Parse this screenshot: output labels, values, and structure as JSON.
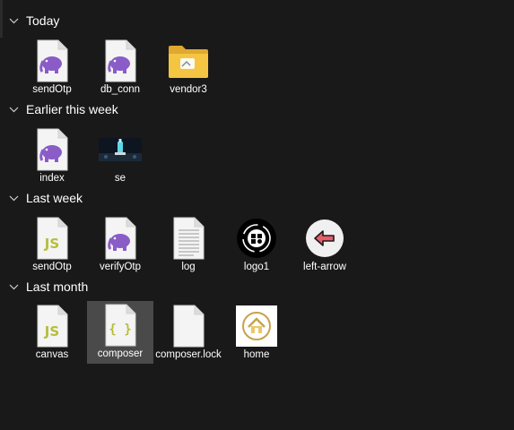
{
  "groups": [
    {
      "title": "Today",
      "items": [
        {
          "name": "sendOtp",
          "icon": "php-file-icon"
        },
        {
          "name": "db_conn",
          "icon": "php-file-icon"
        },
        {
          "name": "vendor3",
          "icon": "folder-icon"
        }
      ]
    },
    {
      "title": "Earlier this week",
      "items": [
        {
          "name": "index",
          "icon": "php-file-icon"
        },
        {
          "name": "se",
          "icon": "image-thumbnail-icon"
        }
      ]
    },
    {
      "title": "Last week",
      "items": [
        {
          "name": "sendOtp",
          "icon": "js-file-icon"
        },
        {
          "name": "verifyOtp",
          "icon": "php-file-icon"
        },
        {
          "name": "log",
          "icon": "text-file-icon"
        },
        {
          "name": "logo1",
          "icon": "logo-image-icon"
        },
        {
          "name": "left-arrow",
          "icon": "left-arrow-image-icon"
        }
      ]
    },
    {
      "title": "Last month",
      "items": [
        {
          "name": "canvas",
          "icon": "js-file-icon"
        },
        {
          "name": "composer",
          "icon": "json-file-icon",
          "selected": true
        },
        {
          "name": "composer.lock",
          "icon": "blank-file-icon"
        },
        {
          "name": "home",
          "icon": "home-image-icon"
        }
      ]
    }
  ],
  "colors": {
    "background": "#191919",
    "selection": "#4a4a4a",
    "php_purple": "#8a5cc7",
    "js_yellow": "#b6bd3c",
    "folder_yellow": "#f4c542"
  }
}
